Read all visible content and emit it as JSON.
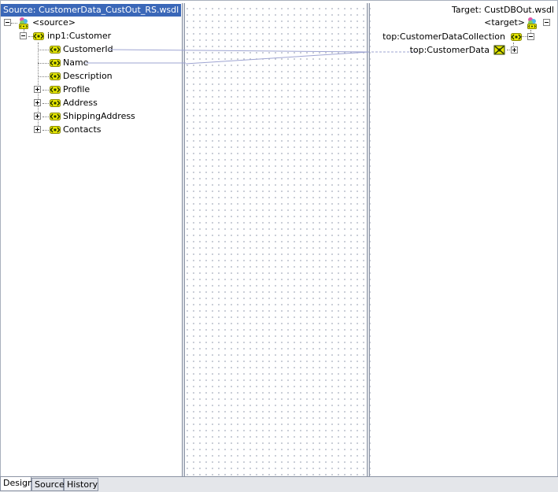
{
  "source": {
    "header": "Source: CustomerData_CustOut_RS.wsdl",
    "root_label": "<source>",
    "customer_label": "inp1:Customer",
    "fields": [
      {
        "label": "CustomerId"
      },
      {
        "label": "Name"
      },
      {
        "label": "Description"
      },
      {
        "label": "Profile"
      },
      {
        "label": "Address"
      },
      {
        "label": "ShippingAddress"
      },
      {
        "label": "Contacts"
      }
    ]
  },
  "target": {
    "header": "Target: CustDBOut.wsdl",
    "root_label": "<target>",
    "collection_label": "top:CustomerDataCollection",
    "data_label": "top:CustomerData"
  },
  "tabs": [
    {
      "label": "Design",
      "active": true
    },
    {
      "label": "Source",
      "active": false
    },
    {
      "label": "History",
      "active": false
    }
  ],
  "colors": {
    "selection": "#3a67b8",
    "mapping_line": "#9ea4d2",
    "element_icon": "#d9d900"
  },
  "icons": {
    "element": "element-icon",
    "root": "schema-root-icon",
    "choice": "choice-element-icon"
  }
}
